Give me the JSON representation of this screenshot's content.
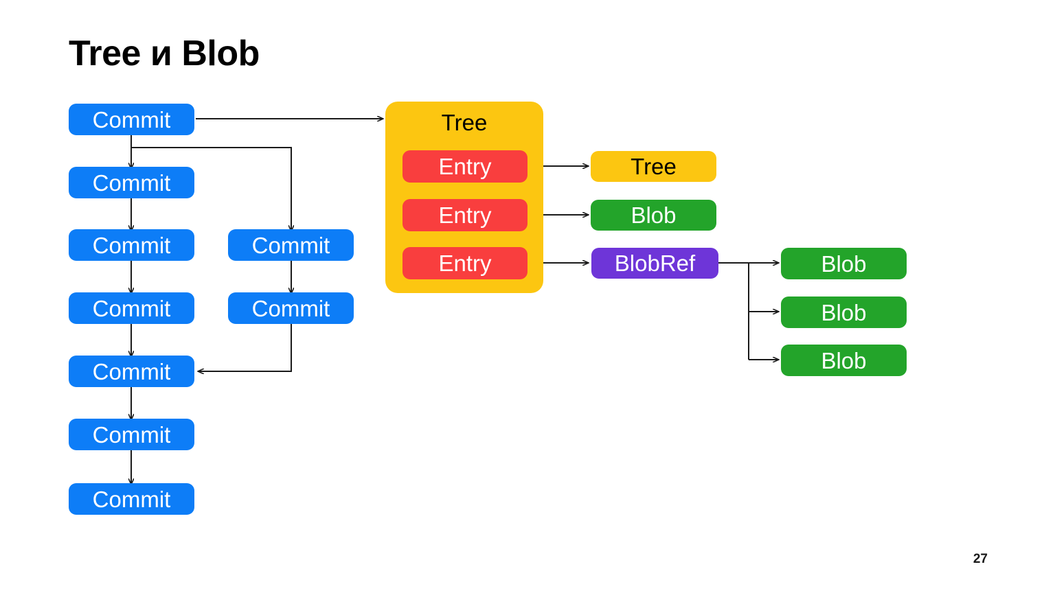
{
  "slide": {
    "title": "Tree и Blob",
    "page_number": "27",
    "background_color": "#ffffff"
  },
  "palette": {
    "commit_blue": "#0d7df7",
    "entry_red": "#f93e3e",
    "tree_amber": "#fcc611",
    "blob_green": "#23a42a",
    "blobref_purple": "#6e35d8",
    "arrow_black": "#1a1a1a",
    "title_black": "#000000"
  },
  "diagram": {
    "type": "node-link-graph",
    "commit_chain_main": [
      {
        "label": "Commit"
      },
      {
        "label": "Commit"
      },
      {
        "label": "Commit"
      },
      {
        "label": "Commit"
      },
      {
        "label": "Commit"
      },
      {
        "label": "Commit"
      },
      {
        "label": "Commit"
      }
    ],
    "commit_chain_branch": [
      {
        "label": "Commit"
      },
      {
        "label": "Commit"
      }
    ],
    "tree_container": {
      "label": "Tree",
      "entries": [
        {
          "label": "Entry"
        },
        {
          "label": "Entry"
        },
        {
          "label": "Entry"
        }
      ]
    },
    "entry_targets": [
      {
        "label": "Tree",
        "kind": "tree"
      },
      {
        "label": "Blob",
        "kind": "blob"
      },
      {
        "label": "BlobRef",
        "kind": "blobref"
      }
    ],
    "blobref_targets": [
      {
        "label": "Blob"
      },
      {
        "label": "Blob"
      },
      {
        "label": "Blob"
      }
    ]
  }
}
